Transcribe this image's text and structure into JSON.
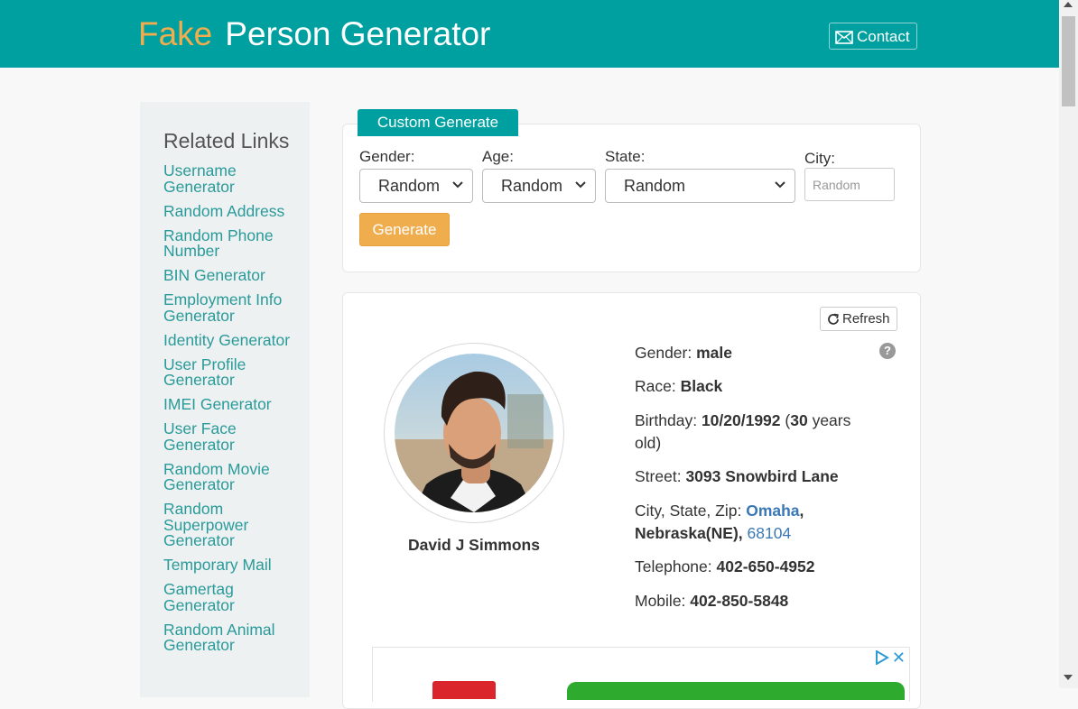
{
  "header": {
    "logo_fake": "Fake",
    "logo_rest": "Person Generator",
    "contact_label": "Contact",
    "contact_icon": "envelope-icon",
    "brand_color": "#00a0a0",
    "accent_color": "#f0ad4e"
  },
  "sidebar": {
    "title": "Related Links",
    "links": [
      "Username Generator",
      "Random Address",
      "Random Phone Number",
      "BIN Generator",
      "Employment Info Generator",
      "Identity Generator",
      "User Profile Generator",
      "IMEI Generator",
      "User Face Generator",
      "Random Movie Generator",
      "Random Superpower Generator",
      "Temporary Mail",
      "Gamertag Generator",
      "Random Animal Generator"
    ]
  },
  "custom_generate": {
    "tab_label": "Custom Generate",
    "gender_label": "Gender:",
    "gender_value": "Random",
    "age_label": "Age:",
    "age_value": "Random",
    "state_label": "State:",
    "state_value": "Random",
    "city_label": "City:",
    "city_placeholder": "Random",
    "generate_label": "Generate"
  },
  "person": {
    "refresh_label": "Refresh",
    "help_icon": "question-circle-icon",
    "name": "David J Simmons",
    "gender_label": "Gender:",
    "gender": "male",
    "race_label": "Race:",
    "race": "Black",
    "birthday_label": "Birthday:",
    "birthday": "10/20/1992",
    "age_open": " (",
    "age": "30",
    "age_suffix": " years old)",
    "street_label": "Street:",
    "street": "3093 Snowbird Lane",
    "city_state_zip_label": "City, State, Zip:",
    "city": "Omaha",
    "state": "Nebraska(NE)",
    "zip": "68104",
    "telephone_label": "Telephone:",
    "telephone": "402-650-4952",
    "mobile_label": "Mobile:",
    "mobile": "402-850-5848"
  },
  "ad": {
    "play_icon": "adchoices-play-icon",
    "close_icon": "close-icon"
  }
}
